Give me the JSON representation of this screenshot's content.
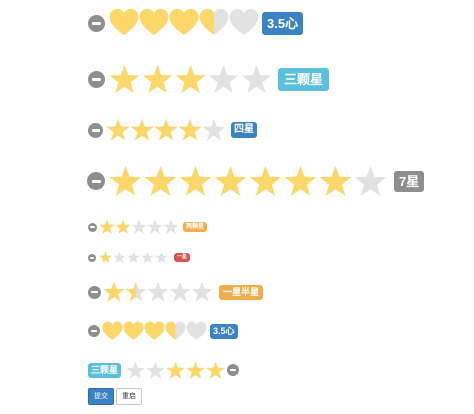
{
  "colors": {
    "filled": "#fcd86a",
    "empty": "#e2e2e2",
    "clear": "#8e8e8e",
    "badges": {
      "primary": "#3a83c6",
      "info": "#5bc0de",
      "default": "#8e8e8e",
      "warning": "#f0ad4e",
      "danger": "#d9534f"
    }
  },
  "ratings": [
    {
      "symbol": "heart",
      "total": 5,
      "value": 3.5,
      "label": "3.5心",
      "label_color": "primary"
    },
    {
      "symbol": "star",
      "total": 5,
      "value": 3,
      "label": "三颗星",
      "label_color": "info"
    },
    {
      "symbol": "star",
      "total": 5,
      "value": 4,
      "label": "四星",
      "label_color": "primary"
    },
    {
      "symbol": "star",
      "total": 8,
      "value": 7,
      "label": "7星",
      "label_color": "default"
    },
    {
      "symbol": "star",
      "total": 5,
      "value": 2,
      "label": "两颗星",
      "label_color": "warning"
    },
    {
      "symbol": "star",
      "total": 5,
      "value": 1,
      "label": "一星",
      "label_color": "danger"
    },
    {
      "symbol": "star",
      "total": 5,
      "value": 1.5,
      "label": "一星半星",
      "label_color": "warning"
    },
    {
      "symbol": "heart",
      "total": 5,
      "value": 3.5,
      "label": "3.5心",
      "label_color": "primary"
    },
    {
      "symbol": "star",
      "total": 5,
      "value": 3,
      "label": "三颗星",
      "label_color": "info",
      "reversed": true
    }
  ],
  "form": {
    "submit_label": "提交",
    "reset_label": "重启"
  }
}
